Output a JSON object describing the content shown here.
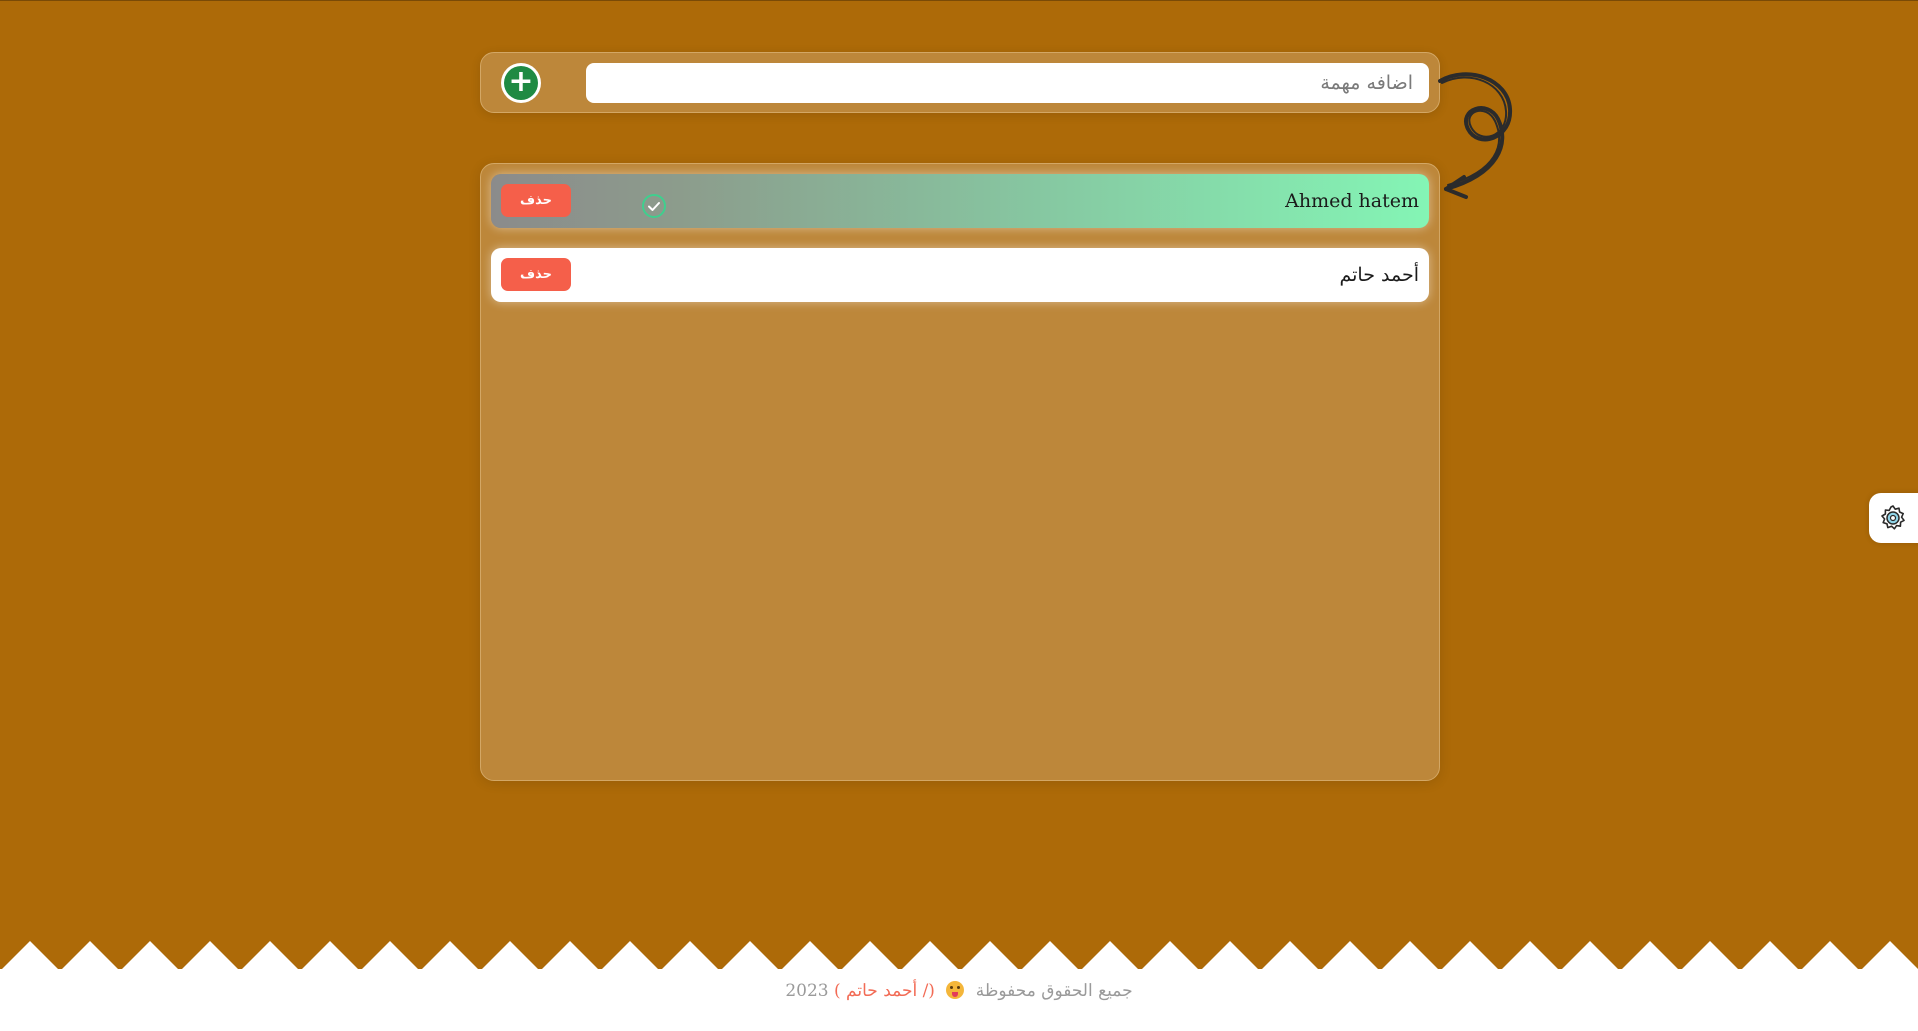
{
  "add_task": {
    "input_placeholder": "اضافه مهمة",
    "input_value": "",
    "add_icon": "plus-circle-icon"
  },
  "tasks": [
    {
      "text": "Ahmed hatem",
      "completed": true,
      "delete_label": "حذف",
      "status_icon": "check-circle-icon"
    },
    {
      "text": "أحمد حاتم",
      "completed": false,
      "delete_label": "حذف"
    }
  ],
  "settings": {
    "icon": "gear-icon"
  },
  "footer": {
    "rights_text": "جميع الحقوق محفوظة",
    "emoji_icon": "tongue-out-face-icon",
    "author_text": "(/ أحمد حاتم )",
    "year": "2023"
  },
  "colors": {
    "background": "#ad6a08",
    "panel": "#bd873a",
    "delete_button": "#f55f4a",
    "add_button": "#1f8a43",
    "completed_gradient_end": "#84f5b5",
    "author_highlight": "#f26b55"
  }
}
